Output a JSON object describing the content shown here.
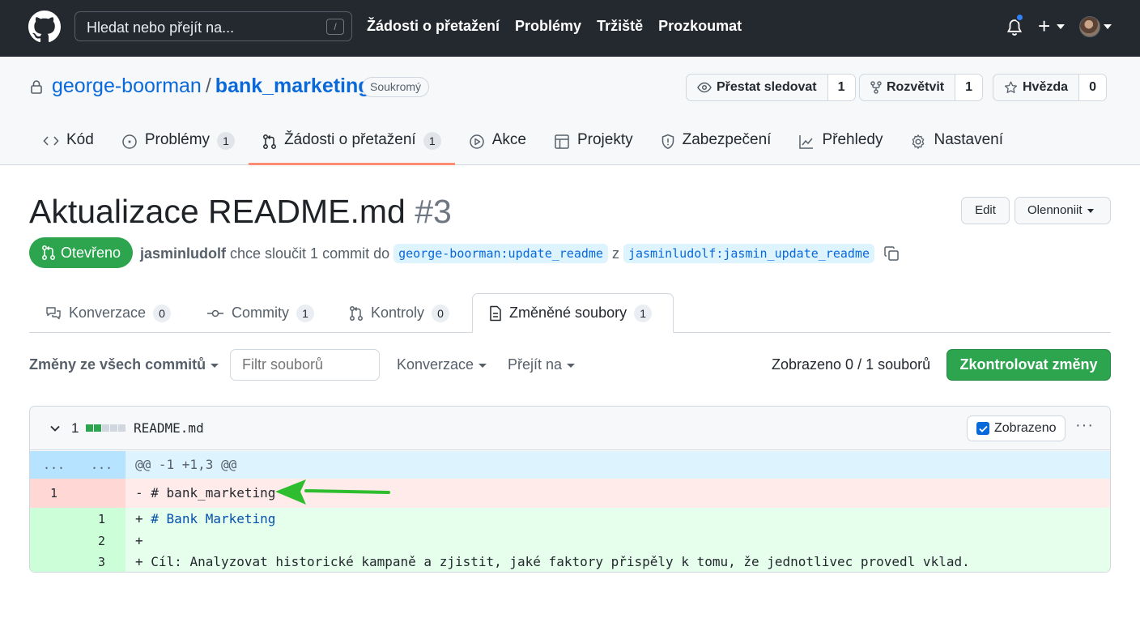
{
  "header": {
    "search_placeholder": "Hledat nebo přejít na...",
    "search_shortcut": "/",
    "nav": [
      "Žádosti o přetažení",
      "Problémy",
      "Tržiště",
      "Prozkoumat"
    ],
    "plus_label": "+"
  },
  "repo": {
    "owner": "george-boorman",
    "separator": "/",
    "name": "bank_marketing",
    "visibility": "Soukromý",
    "watch_label": "Přestat sledovat",
    "watch_count": "1",
    "fork_label": "Rozvětvit",
    "fork_count": "1",
    "star_label": "Hvězda",
    "star_count": "0",
    "tabs": [
      {
        "label": "Kód"
      },
      {
        "label": "Problémy",
        "count": "1"
      },
      {
        "label": "Žádosti o přetažení",
        "count": "1",
        "selected": true
      },
      {
        "label": "Akce"
      },
      {
        "label": "Projekty"
      },
      {
        "label": "Zabezpečení"
      },
      {
        "label": "Přehledy"
      },
      {
        "label": "Nastavení"
      }
    ]
  },
  "pr": {
    "title": "Aktualizace README.md",
    "number": "#3",
    "edit_label": "Edit",
    "code_label": "Olennoniit",
    "state": "Otevřeno",
    "author": "jasminludolf",
    "meta_text": "chce sloučit 1 commit do",
    "base_branch": "george-boorman:update_readme",
    "from_word": "z",
    "head_branch": "jasminludolf:jasmin_update_readme",
    "tabs": [
      {
        "label": "Konverzace",
        "count": "0"
      },
      {
        "label": "Commity",
        "count": "1"
      },
      {
        "label": "Kontroly",
        "count": "0"
      },
      {
        "label": "Změněné soubory",
        "count": "1",
        "selected": true
      }
    ]
  },
  "toolbar": {
    "changes_from": "Změny ze všech commitů",
    "filter_placeholder": "Filtr souborů",
    "conversations": "Konverzace",
    "jump_to": "Přejít na",
    "viewed_count": "Zobrazeno 0 / 1 souborů",
    "review_button": "Zkontrolovat změny"
  },
  "diff": {
    "change_count": "1",
    "file_name": "README.md",
    "viewed_label": "Zobrazeno",
    "viewed_checked": true,
    "more_label": "···",
    "hunk": {
      "old": "...",
      "new": "...",
      "text": "@@ -1 +1,3 @@"
    },
    "lines": [
      {
        "type": "del",
        "old": "1",
        "new": "",
        "sign": "-",
        "text": "# bank_marketing"
      },
      {
        "type": "add",
        "old": "",
        "new": "1",
        "sign": "+",
        "text": "# Bank Marketing"
      },
      {
        "type": "add",
        "old": "",
        "new": "2",
        "sign": "+",
        "text": ""
      },
      {
        "type": "add",
        "old": "",
        "new": "3",
        "sign": "+",
        "text": "Cíl: Analyzovat historické kampaně a zjistit, jaké faktory přispěly k tomu, že jednotlivec provedl vklad."
      }
    ]
  },
  "colors": {
    "header_bg": "#24292f",
    "accent_green": "#2da44e",
    "link_blue": "#0969da",
    "tab_underline": "#fd8c73",
    "annotation_arrow": "#2ebd2e"
  }
}
